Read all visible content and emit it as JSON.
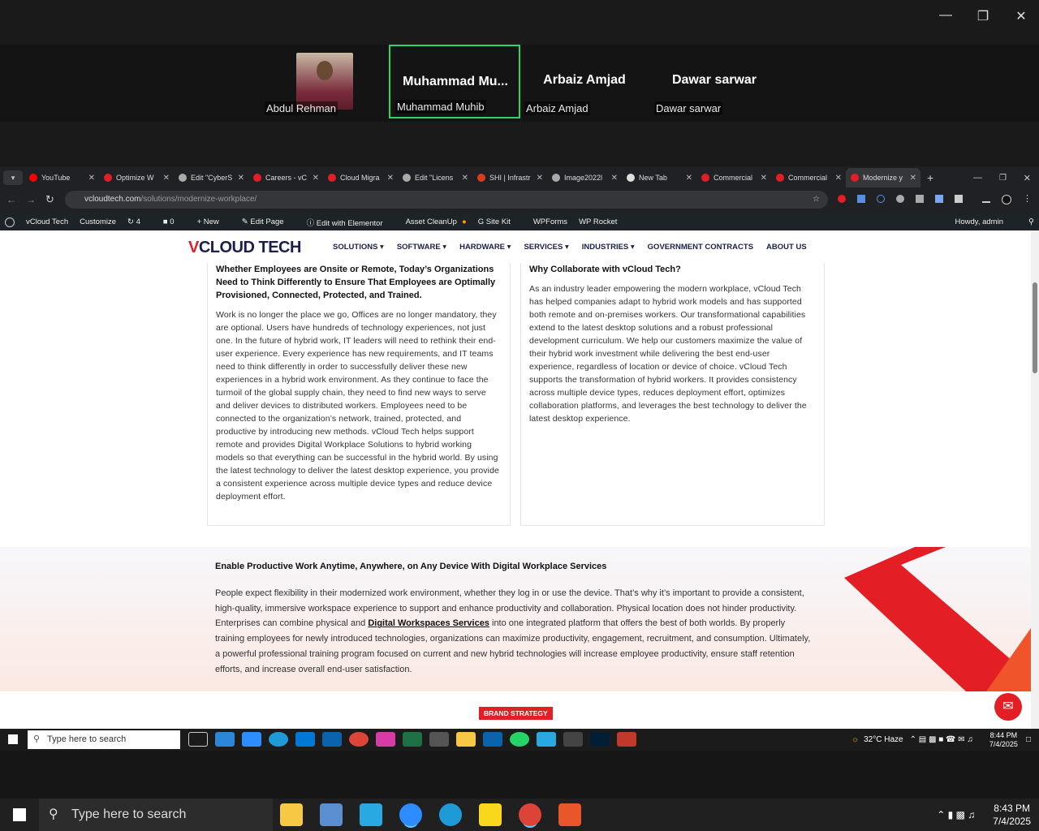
{
  "zoom": {
    "participants": [
      {
        "label": "Abdul Rehman",
        "display": "",
        "has_photo": true,
        "active": false
      },
      {
        "label": "Muhammad Muhib",
        "display": "Muhammad  Mu...",
        "has_photo": false,
        "active": true
      },
      {
        "label": "Arbaiz Amjad",
        "display": "Arbaiz Amjad",
        "has_photo": false,
        "active": false
      },
      {
        "label": "Dawar sarwar",
        "display": "Dawar sarwar",
        "has_photo": false,
        "active": false
      }
    ],
    "active_color": "#2dd36f"
  },
  "browser": {
    "tabs": [
      {
        "label": "YouTube",
        "color": "#ff0000"
      },
      {
        "label": "Optimize W",
        "color": "#e31e24"
      },
      {
        "label": "Edit \"CyberS",
        "color": "#aaaaaa"
      },
      {
        "label": "Careers - vC",
        "color": "#e31e24"
      },
      {
        "label": "Cloud Migra",
        "color": "#e31e24"
      },
      {
        "label": "Edit \"Licens",
        "color": "#aaaaaa"
      },
      {
        "label": "SHI | Infrastr",
        "color": "#e03a1e"
      },
      {
        "label": "Image2022l",
        "color": "#aaaaaa"
      },
      {
        "label": "New Tab",
        "color": "#dddddd"
      },
      {
        "label": "Commercial",
        "color": "#e31e24"
      },
      {
        "label": "Commercial",
        "color": "#e31e24"
      },
      {
        "label": "Modernize y",
        "color": "#e31e24"
      }
    ],
    "url_host": "vcloudtech.com",
    "url_path": "/solutions/modernize-workplace/"
  },
  "wpbar": {
    "items": [
      "vCloud Tech",
      "Customize",
      "4",
      "0",
      "New",
      "Edit Page",
      "Edit with Elementor",
      "Asset CleanUp",
      "Site Kit",
      "WPForms",
      "WP Rocket"
    ],
    "howdy": "Howdy, admin"
  },
  "site": {
    "logo_v": "V",
    "logo_rest": "CLOUD TECH",
    "menu": [
      "SOLUTIONS ▾",
      "SOFTWARE ▾",
      "HARDWARE ▾",
      "SERVICES ▾",
      "INDUSTRIES ▾",
      "GOVERNMENT CONTRACTS",
      "ABOUT US"
    ],
    "left_card": {
      "heading": "Whether Employees are Onsite or Remote, Today’s Organizations Need to Think Differently to Ensure That Employees are Optimally Provisioned, Connected, Protected, and Trained.",
      "body": "Work is no longer the place we go, Offices are no longer mandatory, they are optional. Users have hundreds of technology experiences, not just one.  In the future of hybrid work, IT leaders will need to rethink their end-user experience. Every experience has new requirements, and IT teams need to think differently in order to successfully deliver these new experiences in a hybrid work environment. As they continue to face the turmoil of the global supply chain, they need to find new ways to serve and deliver devices to distributed workers. Employees need to be connected to the organization’s network, trained, protected, and productive by introducing new methods. vCloud Tech helps support remote and provides Digital Workplace Solutions to hybrid working models so that everything can be successful in the hybrid world. By using the latest technology to deliver the latest desktop experience, you provide a consistent experience across multiple device types and reduce device deployment effort."
    },
    "right_card": {
      "heading": "Why Collaborate with vCloud Tech?",
      "body": "As an industry leader empowering the modern workplace, vCloud Tech has helped companies adapt to hybrid work models and has supported both remote and on-premises workers. Our transformational capabilities extend to the latest desktop solutions and a robust professional development curriculum. We help our customers maximize the value of their hybrid work investment while delivering the best end-user experience, regardless of location or device of choice. vCloud Tech supports the transformation of hybrid workers. It provides consistency across multiple device types, reduces deployment effort, optimizes collaboration platforms, and leverages the best technology to deliver the latest desktop experience."
    },
    "band": {
      "heading": "Enable Productive Work Anytime, Anywhere, on Any Device With Digital Workplace Services",
      "body_pre": "People expect flexibility in their modernized work environment, whether they log in or use the device. That’s why it’s important to provide a consistent, high-quality, immersive workspace experience to support and enhance productivity and collaboration. Physical location does not hinder productivity. Enterprises can combine physical and ",
      "link": "Digital Workspaces Services",
      "body_post": " into one integrated platform that offers the best of both worlds. By properly training employees for newly introduced technologies, organizations can maximize productivity, engagement, recruitment, and consumption. Ultimately, a powerful professional training program focused on current and new hybrid technologies will increase employee productivity, ensure staff retention efforts, and increase overall end-user satisfaction."
    },
    "brand_button": "BRAND STRATEGY",
    "accent": "#e31e24"
  },
  "taskbar_inner": {
    "search": "Type here to search",
    "weather": "32°C  Haze",
    "time": "8:44 PM",
    "date": "7/4/2025"
  },
  "taskbar_outer": {
    "search": "Type here to search",
    "time": "8:43 PM",
    "date": "7/4/2025"
  }
}
